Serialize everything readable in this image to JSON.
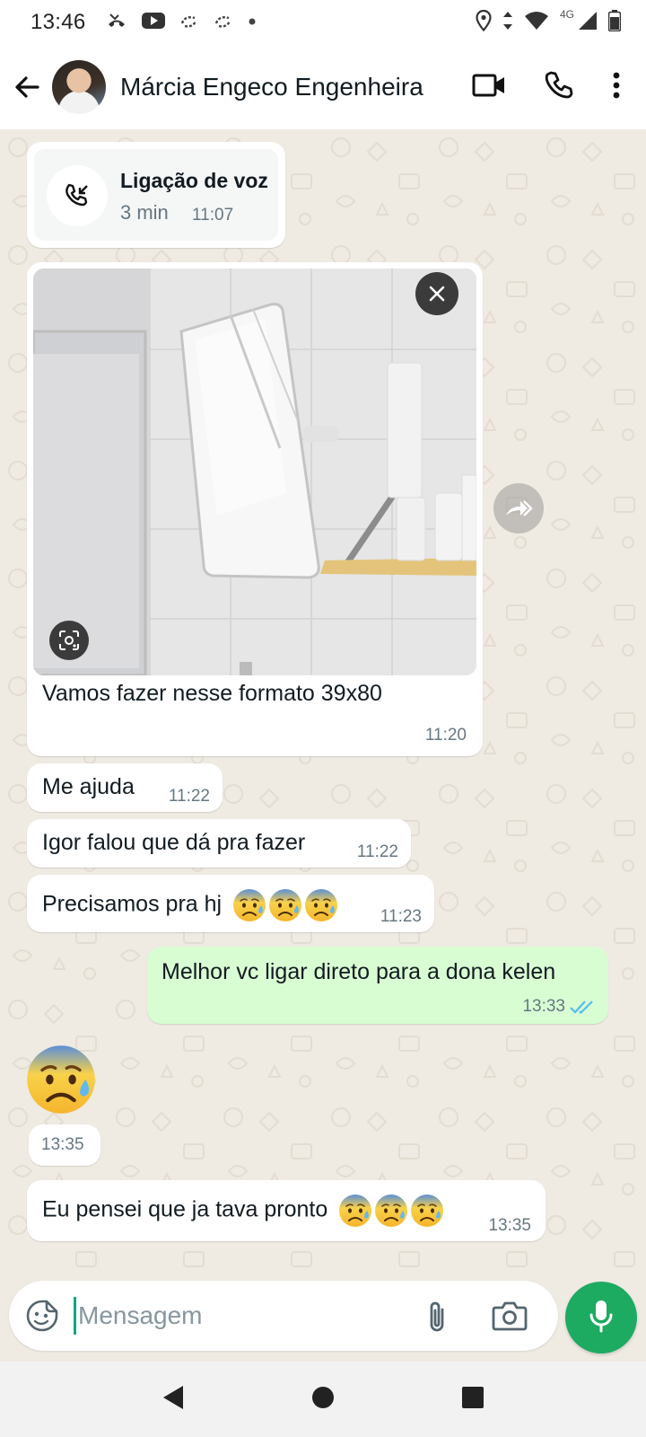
{
  "status_bar": {
    "time": "13:46",
    "network": "4G",
    "left_icons": [
      "missed-call-icon",
      "youtube-icon",
      "sync-icon",
      "sync-icon",
      "dot-icon"
    ],
    "right_icons": [
      "location-icon",
      "data-arrows-icon",
      "wifi-icon",
      "signal-icon",
      "battery-icon"
    ]
  },
  "header": {
    "contact_name": "Márcia Engeco Engenheira",
    "icons": [
      "back-arrow-icon",
      "video-call-icon",
      "voice-call-icon",
      "more-vert-icon"
    ]
  },
  "messages": [
    {
      "type": "call",
      "direction": "in",
      "title": "Ligação de voz",
      "duration": "3 min",
      "time": "11:07"
    },
    {
      "type": "image",
      "direction": "in",
      "caption": "Vamos fazer nesse formato 39x80",
      "time": "11:20"
    },
    {
      "type": "text",
      "direction": "in",
      "text": "Me ajuda",
      "time": "11:22"
    },
    {
      "type": "text",
      "direction": "in",
      "text": "Igor falou que dá pra fazer",
      "time": "11:22"
    },
    {
      "type": "text",
      "direction": "in",
      "text": "Precisamos pra hj",
      "emoji": "anxious-face-with-sweat",
      "emoji_count": 3,
      "time": "11:23"
    },
    {
      "type": "text",
      "direction": "out",
      "text": "Melhor vc ligar direto para a dona kelen",
      "time": "13:33",
      "status": "read"
    },
    {
      "type": "sticker",
      "direction": "in",
      "emoji": "anxious-face-with-sweat",
      "time": "13:35"
    },
    {
      "type": "text",
      "direction": "in",
      "text": "Eu pensei que ja tava pronto",
      "emoji": "anxious-face-with-sweat",
      "emoji_count": 3,
      "time": "13:35"
    }
  ],
  "composer": {
    "placeholder": "Mensagem",
    "value": "",
    "icons": [
      "sticker-icon",
      "attach-icon",
      "camera-icon",
      "mic-icon"
    ]
  },
  "nav_bar": {
    "icons": [
      "nav-back-icon",
      "nav-home-icon",
      "nav-recents-icon"
    ]
  },
  "colors": {
    "chat_background": "#efeae2",
    "incoming_bubble": "#ffffff",
    "outgoing_bubble": "#d9fdd3",
    "accent_green": "#1daa61",
    "read_ticks": "#53bdeb",
    "meta_text": "#667781"
  }
}
